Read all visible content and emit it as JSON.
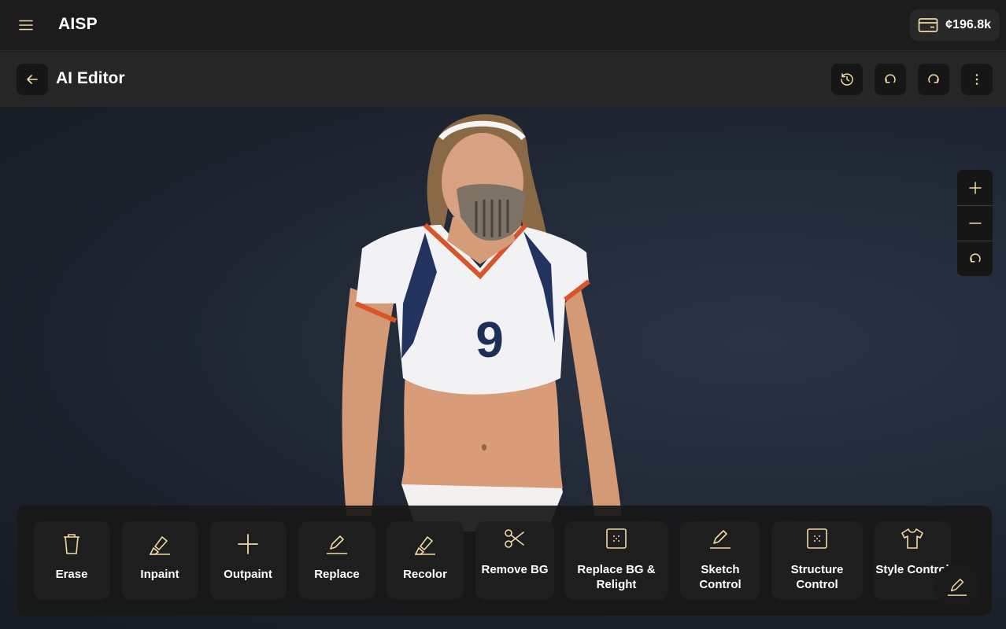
{
  "app": {
    "title": "AISP"
  },
  "header": {
    "credits": "¢196.8k",
    "menu_icon": "hamburger-icon",
    "wallet_icon": "wallet-icon"
  },
  "editor": {
    "title": "AI Editor",
    "actions": [
      "history-icon",
      "undo-icon",
      "redo-icon",
      "more-vertical-icon"
    ]
  },
  "zoom": {
    "controls": [
      "zoom-in-icon",
      "zoom-out-icon",
      "reset-zoom-icon"
    ]
  },
  "jersey": {
    "number": "9"
  },
  "tools": [
    {
      "label": "Erase",
      "icon": "trash-icon"
    },
    {
      "label": "Inpaint",
      "icon": "brush-icon"
    },
    {
      "label": "Outpaint",
      "icon": "plus-icon"
    },
    {
      "label": "Replace",
      "icon": "pencil-icon"
    },
    {
      "label": "Recolor",
      "icon": "brush-icon"
    },
    {
      "label": "Remove BG",
      "icon": "scissors-icon"
    },
    {
      "label": "Replace BG & Relight",
      "icon": "dotted-square-icon"
    },
    {
      "label": "Sketch Control",
      "icon": "pencil-icon"
    },
    {
      "label": "Structure Control",
      "icon": "dotted-square-icon"
    },
    {
      "label": "Style Control",
      "icon": "shirt-icon"
    }
  ],
  "colors": {
    "accent": "#f1d9a7",
    "background": "#1c1c1c",
    "button": "#161616"
  }
}
